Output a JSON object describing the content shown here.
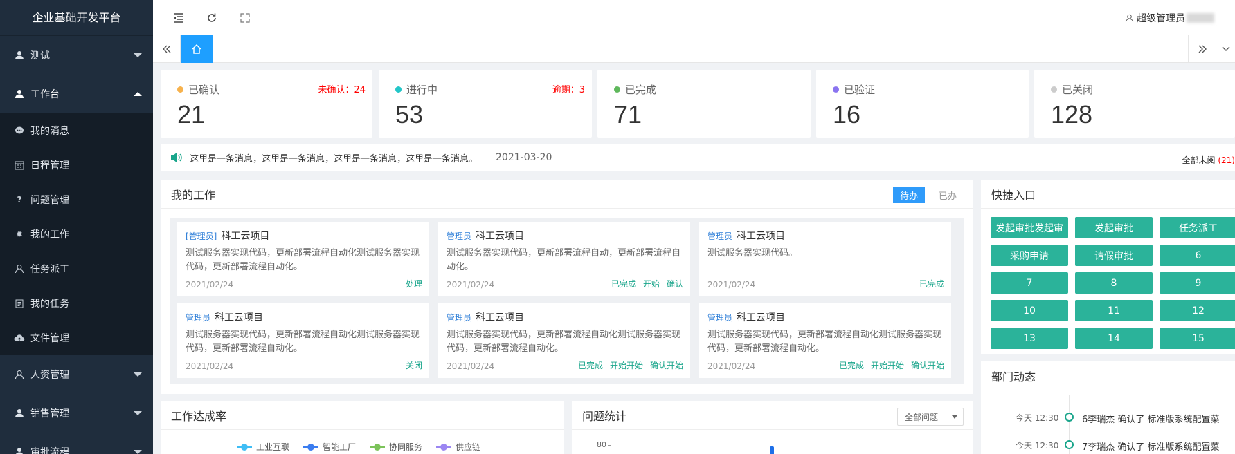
{
  "app": {
    "title": "企业基础开发平台"
  },
  "sidebar": {
    "items": [
      {
        "label": "测试",
        "icon": "user-icon",
        "expanded": false
      },
      {
        "label": "工作台",
        "icon": "user-icon",
        "expanded": true,
        "children": [
          {
            "label": "我的消息",
            "icon": "chat-icon"
          },
          {
            "label": "日程管理",
            "icon": "calendar-icon"
          },
          {
            "label": "问题管理",
            "icon": "question-icon"
          },
          {
            "label": "我的工作",
            "icon": "gear-icon"
          },
          {
            "label": "任务派工",
            "icon": "person-icon"
          },
          {
            "label": "我的任务",
            "icon": "clipboard-icon"
          },
          {
            "label": "文件管理",
            "icon": "cloud-upload-icon"
          }
        ]
      },
      {
        "label": "人资管理",
        "icon": "person-icon",
        "expanded": false
      },
      {
        "label": "销售管理",
        "icon": "user-icon",
        "expanded": false
      },
      {
        "label": "审批流程",
        "icon": "user-icon",
        "expanded": false
      }
    ]
  },
  "topbar": {
    "user": "超级管理员"
  },
  "stats": [
    {
      "label": "已确认",
      "value": "21",
      "dot": "#f7b24d",
      "warn": "未确认：24"
    },
    {
      "label": "进行中",
      "value": "53",
      "dot": "#23c6c8",
      "warn": "逾期：3"
    },
    {
      "label": "已完成",
      "value": "71",
      "dot": "#5fb85c",
      "warn": ""
    },
    {
      "label": "已验证",
      "value": "16",
      "dot": "#8a74f0",
      "warn": ""
    },
    {
      "label": "已关闭",
      "value": "128",
      "dot": "#cccccc",
      "warn": ""
    }
  ],
  "notice": {
    "text": "这里是一条消息，这里是一条消息，这里是一条消息，这里是一条消息。",
    "date": "2021-03-20",
    "unread_label": "全部未阅",
    "unread_count": "(21)"
  },
  "work": {
    "title": "我的工作",
    "tab_pending": "待办",
    "tab_done": "已办",
    "cards": [
      {
        "role": "[管理员]",
        "title": "科工云项目",
        "desc": "测试服务器实现代码，更新部署流程自动化测试服务器实现代码，更新部署流程自动化。",
        "date": "2021/02/24",
        "actions": [
          "处理"
        ]
      },
      {
        "role": "管理员",
        "title": "科工云项目",
        "desc": "测试服务器实现代码，更新部署流程自动，更新部署流程自动化。",
        "date": "2021/02/24",
        "actions": [
          "已完成",
          "开始",
          "确认"
        ]
      },
      {
        "role": "管理员",
        "title": "科工云项目",
        "desc": "测试服务器实现代码。",
        "date": "2021/02/24",
        "actions": [
          "已完成"
        ]
      },
      {
        "role": "管理员",
        "title": "科工云项目",
        "desc": "测试服务器实现代码，更新部署流程自动化测试服务器实现代码，更新部署流程自动化。",
        "date": "2021/02/24",
        "actions": [
          "关闭"
        ]
      },
      {
        "role": "管理员",
        "title": "科工云项目",
        "desc": "测试服务器实现代码，更新部署流程自动化测试服务器实现代码，更新部署流程自动化。",
        "date": "2021/02/24",
        "actions": [
          "已完成",
          "开始开始",
          "确认开始"
        ]
      },
      {
        "role": "管理员",
        "title": "科工云项目",
        "desc": "测试服务器实现代码，更新部署流程自动化测试服务器实现代码，更新部署流程自动化。",
        "date": "2021/02/24",
        "actions": [
          "已完成",
          "开始开始",
          "确认开始"
        ]
      }
    ]
  },
  "quick": {
    "title": "快捷入口",
    "buttons": [
      "发起审批发起审",
      "发起审批",
      "任务派工",
      "采购申请",
      "请假审批",
      "6",
      "7",
      "8",
      "9",
      "10",
      "11",
      "12",
      "13",
      "14",
      "15"
    ]
  },
  "dept": {
    "title": "部门动态",
    "items": [
      {
        "time": "今天 12:30",
        "text": "6李瑞杰 确认了 标准版系统配置菜"
      },
      {
        "time": "今天 12:30",
        "text": "7李瑞杰 确认了 标准版系统配置菜"
      }
    ]
  },
  "rate": {
    "title": "工作达成率",
    "legend": [
      {
        "name": "工业互联",
        "color": "#3fbdf5"
      },
      {
        "name": "智能工厂",
        "color": "#3b7df0"
      },
      {
        "name": "协同服务",
        "color": "#7cc35a"
      },
      {
        "name": "供应链",
        "color": "#9b86f2"
      }
    ]
  },
  "issues": {
    "title": "问题统计",
    "filter": "全部问题",
    "y_tick": "80"
  }
}
